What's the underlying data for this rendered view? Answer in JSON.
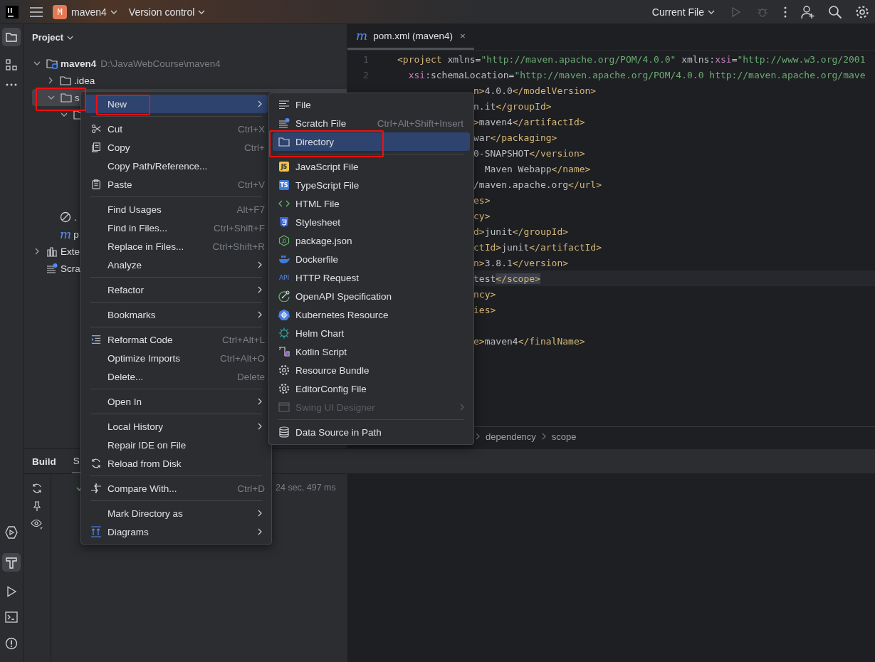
{
  "top_bar": {
    "project_badge": "M",
    "project": "maven4",
    "vcs": "Version control",
    "run_config": "Current File"
  },
  "project_panel": {
    "title": "Project",
    "tree": [
      {
        "kind": "module",
        "label": "maven4",
        "path": "D:\\JavaWebCourse\\maven4",
        "expanded": true,
        "children": [
          {
            "kind": "folder",
            "label": ".idea",
            "expanded": false
          },
          {
            "kind": "folder",
            "label": "s",
            "expanded": true,
            "selected": true,
            "outlined": true,
            "children": [
              {
                "kind": "folder",
                "expanded": true
              }
            ]
          },
          {
            "kind": "ignore",
            "label": "."
          },
          {
            "kind": "maven",
            "icon_text": "m",
            "label": "p"
          }
        ]
      },
      {
        "kind": "libraries",
        "label": "Exte",
        "expanded": false
      },
      {
        "kind": "scratch",
        "label": "Scra"
      }
    ]
  },
  "editor": {
    "tab": {
      "icon_text": "m",
      "label": "pom.xml (maven4)",
      "close": "×"
    },
    "line_numbers": [
      "1",
      "2"
    ],
    "lines": [
      {
        "current": false,
        "tokens": [
          {
            "kind": "tag",
            "text": "<project"
          },
          {
            "kind": "attr",
            "text": " xmlns"
          },
          {
            "kind": "text",
            "text": "="
          },
          {
            "kind": "value",
            "text": "\"http://maven.apache.org/POM/4.0.0\""
          },
          {
            "kind": "attr",
            "text": " xmlns"
          },
          {
            "kind": "text",
            "text": ":"
          },
          {
            "kind": "ns",
            "text": "xsi"
          },
          {
            "kind": "text",
            "text": "="
          },
          {
            "kind": "value",
            "text": "\"http://www.w3.org/2001"
          }
        ]
      },
      {
        "current": false,
        "tokens": [
          {
            "kind": "ns",
            "text": "  xsi"
          },
          {
            "kind": "attr",
            "text": ":schemaLocation"
          },
          {
            "kind": "text",
            "text": "="
          },
          {
            "kind": "value",
            "text": "\"http://maven.apache.org/POM/4.0.0 http://maven.apache.org/mave"
          }
        ]
      },
      {
        "current": false,
        "tokens": [
          {
            "kind": "tag",
            "text": "n>"
          },
          {
            "kind": "text",
            "text": "4.0.0"
          },
          {
            "kind": "tag",
            "text": "</modelVersion>"
          }
        ]
      },
      {
        "current": false,
        "tokens": [
          {
            "kind": "text",
            "text": "n.it"
          },
          {
            "kind": "tag",
            "text": "</groupId>"
          }
        ]
      },
      {
        "current": false,
        "tokens": [
          {
            "kind": "tag",
            "text": ">"
          },
          {
            "kind": "text",
            "text": "maven4"
          },
          {
            "kind": "tag",
            "text": "</artifactId>"
          }
        ]
      },
      {
        "current": false,
        "tokens": [
          {
            "kind": "text",
            "text": "war"
          },
          {
            "kind": "tag",
            "text": "</packaging>"
          }
        ]
      },
      {
        "current": false,
        "tokens": [
          {
            "kind": "text",
            "text": "0-SNAPSHOT"
          },
          {
            "kind": "tag",
            "text": "</version>"
          }
        ]
      },
      {
        "current": false,
        "tokens": [
          {
            "kind": "text",
            "text": "  Maven Webapp"
          },
          {
            "kind": "tag",
            "text": "</name>"
          }
        ]
      },
      {
        "current": false,
        "tokens": [
          {
            "kind": "text",
            "text": "/maven.apache.org"
          },
          {
            "kind": "tag",
            "text": "</url>"
          }
        ]
      },
      {
        "current": false,
        "tokens": [
          {
            "kind": "tag",
            "text": "es>"
          }
        ]
      },
      {
        "current": false,
        "tokens": [
          {
            "kind": "tag",
            "text": "cy>"
          }
        ]
      },
      {
        "current": false,
        "tokens": [
          {
            "kind": "tag",
            "text": "d>"
          },
          {
            "kind": "text",
            "text": "junit"
          },
          {
            "kind": "tag",
            "text": "</groupId>"
          }
        ]
      },
      {
        "current": false,
        "tokens": [
          {
            "kind": "tag",
            "text": "ctId>"
          },
          {
            "kind": "text",
            "text": "junit"
          },
          {
            "kind": "tag",
            "text": "</artifactId>"
          }
        ]
      },
      {
        "current": false,
        "tokens": [
          {
            "kind": "tag",
            "text": "n>"
          },
          {
            "kind": "text",
            "text": "3.8.1"
          },
          {
            "kind": "tag",
            "text": "</version>"
          }
        ]
      },
      {
        "current": true,
        "tokens": [
          {
            "kind": "text",
            "text": "test"
          },
          {
            "kind": "match",
            "text": "</scope>"
          }
        ]
      },
      {
        "current": false,
        "tokens": [
          {
            "kind": "tag",
            "text": "ncy>"
          }
        ]
      },
      {
        "current": false,
        "tokens": [
          {
            "kind": "tag",
            "text": "ies>"
          }
        ]
      },
      {
        "current": false
      },
      {
        "current": false,
        "tokens": [
          {
            "kind": "tag",
            "text": "e>"
          },
          {
            "kind": "text",
            "text": "maven4"
          },
          {
            "kind": "tag",
            "text": "</finalName>"
          }
        ]
      }
    ],
    "breadcrumbs": [
      "dependency",
      "scope"
    ]
  },
  "build_panel": {
    "title": "Build",
    "tabs": [
      {
        "label": "S",
        "selected": true
      }
    ],
    "status": "24 sec, 497 ms"
  },
  "context_menu": {
    "groups": [
      [
        {
          "label": "New",
          "submenu": true,
          "selected": true,
          "outlined": true
        }
      ],
      [
        {
          "label": "Cut",
          "kind": "cut",
          "shortcut": "Ctrl+X"
        },
        {
          "label": "Copy",
          "kind": "copy",
          "shortcut": "Ctrl+"
        },
        {
          "label": "Copy Path/Reference..."
        },
        {
          "label": "Paste",
          "kind": "paste",
          "shortcut": "Ctrl+V"
        }
      ],
      [
        {
          "label": "Find Usages",
          "shortcut": "Alt+F7"
        },
        {
          "label": "Find in Files...",
          "shortcut": "Ctrl+Shift+F"
        },
        {
          "label": "Replace in Files...",
          "shortcut": "Ctrl+Shift+R"
        },
        {
          "label": "Analyze",
          "submenu": true
        }
      ],
      [
        {
          "label": "Refactor",
          "submenu": true
        }
      ],
      [
        {
          "label": "Bookmarks",
          "submenu": true
        }
      ],
      [
        {
          "label": "Reformat Code",
          "kind": "reformat",
          "shortcut": "Ctrl+Alt+L"
        },
        {
          "label": "Optimize Imports",
          "shortcut": "Ctrl+Alt+O"
        },
        {
          "label": "Delete...",
          "shortcut": "Delete"
        }
      ],
      [
        {
          "label": "Open In",
          "submenu": true
        }
      ],
      [
        {
          "label": "Local History",
          "submenu": true
        },
        {
          "label": "Repair IDE on File"
        },
        {
          "label": "Reload from Disk",
          "kind": "reload"
        }
      ],
      [
        {
          "label": "Compare With...",
          "kind": "compare",
          "shortcut": "Ctrl+D"
        }
      ],
      [
        {
          "label": "Mark Directory as",
          "submenu": true
        },
        {
          "label": "Diagrams",
          "kind": "diagrams",
          "submenu": true
        }
      ]
    ]
  },
  "new_submenu": {
    "groups": [
      [
        {
          "label": "File",
          "kind": "text-file"
        },
        {
          "label": "Scratch File",
          "kind": "scratch",
          "shortcut": "Ctrl+Alt+Shift+Insert"
        },
        {
          "label": "Directory",
          "kind": "directory",
          "selected": true,
          "outlined": true
        }
      ],
      [
        {
          "label": "JavaScript File",
          "kind": "javascript",
          "icon_text": "JS"
        },
        {
          "label": "TypeScript File",
          "kind": "typescript",
          "icon_text": "TS"
        },
        {
          "label": "HTML File",
          "kind": "html"
        },
        {
          "label": "Stylesheet",
          "kind": "stylesheet"
        },
        {
          "label": "package.json",
          "kind": "package"
        },
        {
          "label": "Dockerfile",
          "kind": "docker"
        },
        {
          "label": "HTTP Request",
          "kind": "http",
          "icon_text": "API"
        },
        {
          "label": "OpenAPI Specification",
          "kind": "openapi"
        },
        {
          "label": "Kubernetes Resource",
          "kind": "kubernetes"
        },
        {
          "label": "Helm Chart",
          "kind": "helm"
        },
        {
          "label": "Kotlin Script",
          "kind": "kotlin"
        },
        {
          "label": "Resource Bundle",
          "kind": "resource"
        },
        {
          "label": "EditorConfig File",
          "kind": "editorconfig"
        },
        {
          "label": "Swing UI Designer",
          "kind": "swing",
          "disabled": true,
          "submenu": true
        }
      ],
      [
        {
          "label": "Data Source in Path",
          "kind": "datasource"
        }
      ]
    ]
  }
}
